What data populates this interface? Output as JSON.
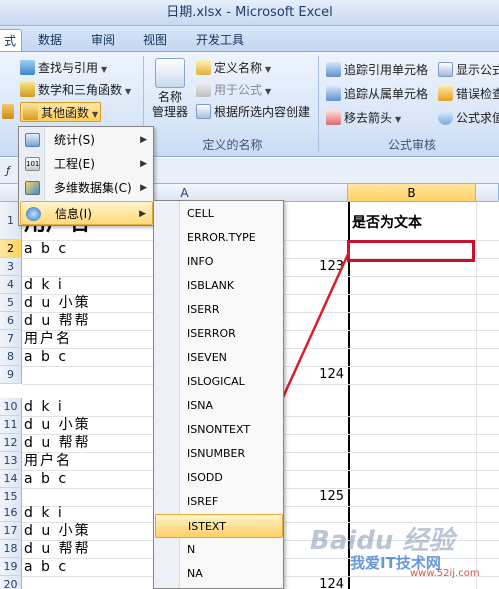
{
  "window": {
    "title": "日期.xlsx - Microsoft Excel"
  },
  "tabs": [
    {
      "label": "式",
      "active": true
    },
    {
      "label": "数据",
      "active": false
    },
    {
      "label": "审阅",
      "active": false
    },
    {
      "label": "视图",
      "active": false
    },
    {
      "label": "开发工具",
      "active": false
    }
  ],
  "ribbon": {
    "lookup": "查找与引用",
    "math": "数学和三角函数",
    "other": "其他函数",
    "name_manager": "名称\n管理器",
    "define_name": "定义名称",
    "use_in_formula": "用于公式",
    "create_from_selection": "根据所选内容创建",
    "defined_names_group": "定义的名称",
    "trace_precedents": "追踪引用单元格",
    "trace_dependents": "追踪从属单元格",
    "remove_arrows": "移去箭头",
    "show_formulas": "显示公式",
    "error_check": "错误检查",
    "evaluate": "公式求值",
    "auditing_group": "公式审核"
  },
  "grid": {
    "columns": [
      {
        "label": "A",
        "selected": false
      },
      {
        "label": "B",
        "selected": true
      }
    ],
    "rows": [
      "1",
      "2",
      "3",
      "4",
      "5",
      "6",
      "7",
      "8",
      "9",
      "10",
      "11",
      "12",
      "13",
      "14",
      "15",
      "16",
      "17",
      "18",
      "19",
      "20"
    ],
    "selected_row": "2",
    "a1": "用户名",
    "b1": "是否为文本",
    "colA": [
      "",
      "a b c",
      "",
      "d k i",
      "d u 小策",
      "d u 帮帮",
      "用户名",
      "a b c",
      "",
      "d k i",
      "d u 小策",
      "d u 帮帮",
      "用户名",
      "a b c",
      "",
      "d k i",
      "d u 小策",
      "d u 帮帮",
      "a b c",
      ""
    ],
    "numbers": [
      {
        "row": 3,
        "value": "123"
      },
      {
        "row": 9,
        "value": "124"
      },
      {
        "row": 15,
        "value": "125"
      },
      {
        "row": 20,
        "value": "124"
      }
    ]
  },
  "menu": {
    "items": [
      {
        "label": "统计(S)",
        "highlighted": false
      },
      {
        "label": "工程(E)",
        "highlighted": false
      },
      {
        "label": "多维数据集(C)",
        "highlighted": false
      },
      {
        "label": "信息(I)",
        "highlighted": true
      }
    ],
    "submenu": [
      "CELL",
      "ERROR.TYPE",
      "INFO",
      "ISBLANK",
      "ISERR",
      "ISERROR",
      "ISEVEN",
      "ISLOGICAL",
      "ISNA",
      "ISNONTEXT",
      "ISNUMBER",
      "ISODD",
      "ISREF",
      "ISTEXT",
      "N",
      "NA"
    ],
    "submenu_highlight": "ISTEXT"
  },
  "watermark": {
    "baidu": "Baidu 经验",
    "site": "我爱IT技术网",
    "url": "www.52ij.com"
  },
  "colors": {
    "highlight": "#ffd978",
    "selection_border": "#c8102e",
    "arrow": "#d81e2a"
  }
}
